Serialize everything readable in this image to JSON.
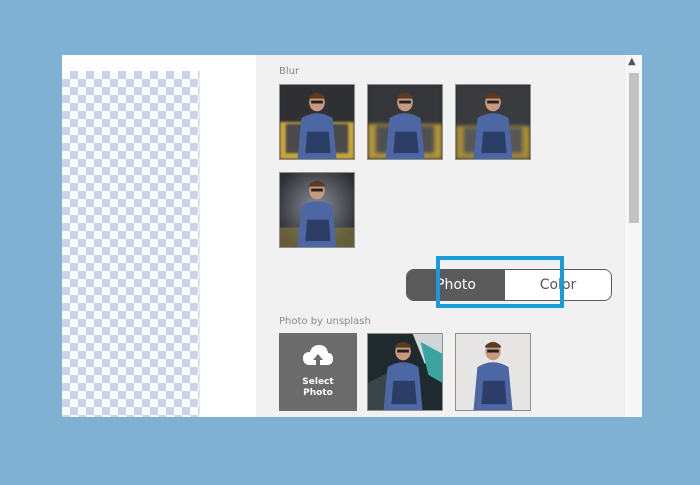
{
  "panel": {
    "blur_label": "Blur",
    "photo_by_label": "Photo by unsplash"
  },
  "toggle": {
    "photo_label": "Photo",
    "color_label": "Color",
    "selected": "Color"
  },
  "select_photo": {
    "line1": "Select",
    "line2": "Photo",
    "icon": "cloud-upload-icon"
  },
  "colors": {
    "page_background": "#7fb2d2",
    "highlight": "#1a9ad6",
    "photo_button": "#5a5a5a",
    "select_tile": "#6b6b6b"
  }
}
